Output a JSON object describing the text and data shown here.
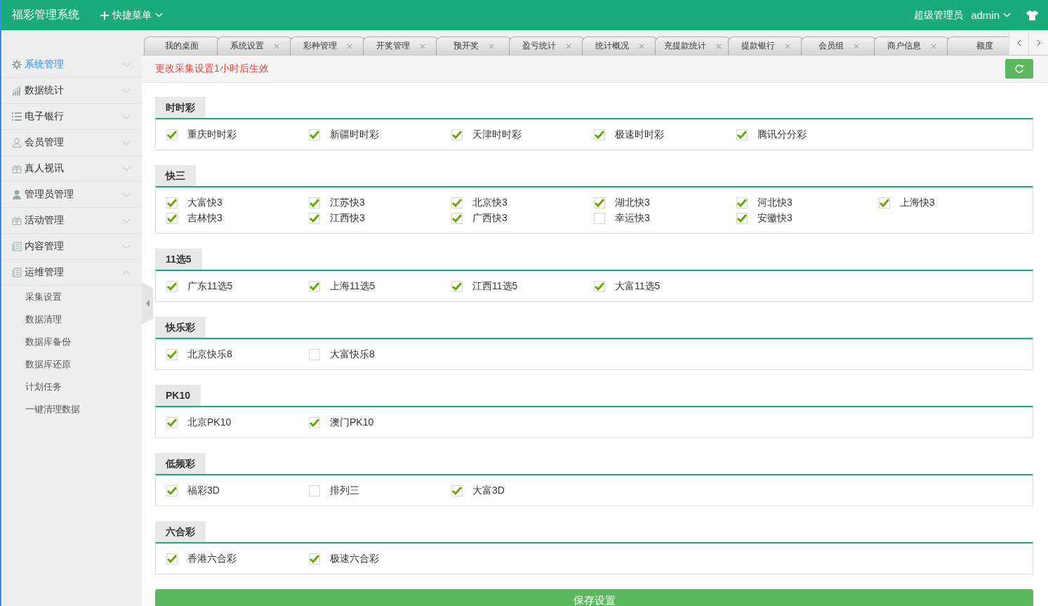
{
  "header": {
    "title": "福彩管理系统",
    "quick_menu": "快捷菜单",
    "role": "超级管理员",
    "user": "admin"
  },
  "sidebar": {
    "items": [
      {
        "label": "系统管理",
        "selected": true,
        "expanded": false
      },
      {
        "label": "数据统计",
        "selected": false,
        "expanded": false
      },
      {
        "label": "电子银行",
        "selected": false,
        "expanded": false
      },
      {
        "label": "会员管理",
        "selected": false,
        "expanded": false
      },
      {
        "label": "真人视讯",
        "selected": false,
        "expanded": false
      },
      {
        "label": "管理员管理",
        "selected": false,
        "expanded": false
      },
      {
        "label": "活动管理",
        "selected": false,
        "expanded": false
      },
      {
        "label": "内容管理",
        "selected": false,
        "expanded": false
      },
      {
        "label": "运维管理",
        "selected": false,
        "expanded": true,
        "children": [
          {
            "label": "采集设置",
            "selected": false
          },
          {
            "label": "数据清理",
            "selected": false
          },
          {
            "label": "数据库备份",
            "selected": false
          },
          {
            "label": "数据库还原",
            "selected": false
          },
          {
            "label": "计划任务",
            "selected": false
          },
          {
            "label": "一键清理数据",
            "selected": false
          }
        ]
      }
    ]
  },
  "tabs": [
    {
      "label": "我的桌面",
      "selected": false,
      "closable": false
    },
    {
      "label": "系统设置",
      "selected": false,
      "closable": true
    },
    {
      "label": "彩种管理",
      "selected": false,
      "closable": true
    },
    {
      "label": "开奖管理",
      "selected": false,
      "closable": true
    },
    {
      "label": "预开奖",
      "selected": false,
      "closable": true
    },
    {
      "label": "盈亏统计",
      "selected": false,
      "closable": true
    },
    {
      "label": "统计概况",
      "selected": false,
      "closable": true
    },
    {
      "label": "充提款统计",
      "selected": false,
      "closable": true
    },
    {
      "label": "提款银行",
      "selected": false,
      "closable": true
    },
    {
      "label": "会员组",
      "selected": false,
      "closable": true
    },
    {
      "label": "商户信息",
      "selected": false,
      "closable": true
    },
    {
      "label": "额度",
      "selected": false,
      "closable": false
    }
  ],
  "notice": "更改采集设置1小时后生效",
  "sections": [
    {
      "title": "时时彩",
      "options": [
        {
          "label": "重庆时时彩",
          "checked": true
        },
        {
          "label": "新疆时时彩",
          "checked": true
        },
        {
          "label": "天津时时彩",
          "checked": true
        },
        {
          "label": "极速时时彩",
          "checked": true
        },
        {
          "label": "腾讯分分彩",
          "checked": true
        }
      ]
    },
    {
      "title": "快三",
      "options": [
        {
          "label": "大富快3",
          "checked": true
        },
        {
          "label": "江苏快3",
          "checked": true
        },
        {
          "label": "北京快3",
          "checked": true
        },
        {
          "label": "湖北快3",
          "checked": true
        },
        {
          "label": "河北快3",
          "checked": true
        },
        {
          "label": "上海快3",
          "checked": true
        },
        {
          "label": "吉林快3",
          "checked": true
        },
        {
          "label": "江西快3",
          "checked": true
        },
        {
          "label": "广西快3",
          "checked": true
        },
        {
          "label": "幸运快3",
          "checked": false
        },
        {
          "label": "安徽快3",
          "checked": true
        }
      ]
    },
    {
      "title": "11选5",
      "options": [
        {
          "label": "广东11选5",
          "checked": true
        },
        {
          "label": "上海11选5",
          "checked": true
        },
        {
          "label": "江西11选5",
          "checked": true
        },
        {
          "label": "大富11选5",
          "checked": true
        }
      ]
    },
    {
      "title": "快乐彩",
      "options": [
        {
          "label": "北京快乐8",
          "checked": true
        },
        {
          "label": "大富快乐8",
          "checked": false
        }
      ]
    },
    {
      "title": "PK10",
      "options": [
        {
          "label": "北京PK10",
          "checked": true
        },
        {
          "label": "澳门PK10",
          "checked": true
        }
      ]
    },
    {
      "title": "低频彩",
      "options": [
        {
          "label": "福彩3D",
          "checked": true
        },
        {
          "label": "排列三",
          "checked": false
        },
        {
          "label": "大富3D",
          "checked": true
        }
      ]
    },
    {
      "title": "六合彩",
      "options": [
        {
          "label": "香港六合彩",
          "checked": true
        },
        {
          "label": "极速六合彩",
          "checked": true
        }
      ]
    }
  ],
  "save_button": "保存设置"
}
